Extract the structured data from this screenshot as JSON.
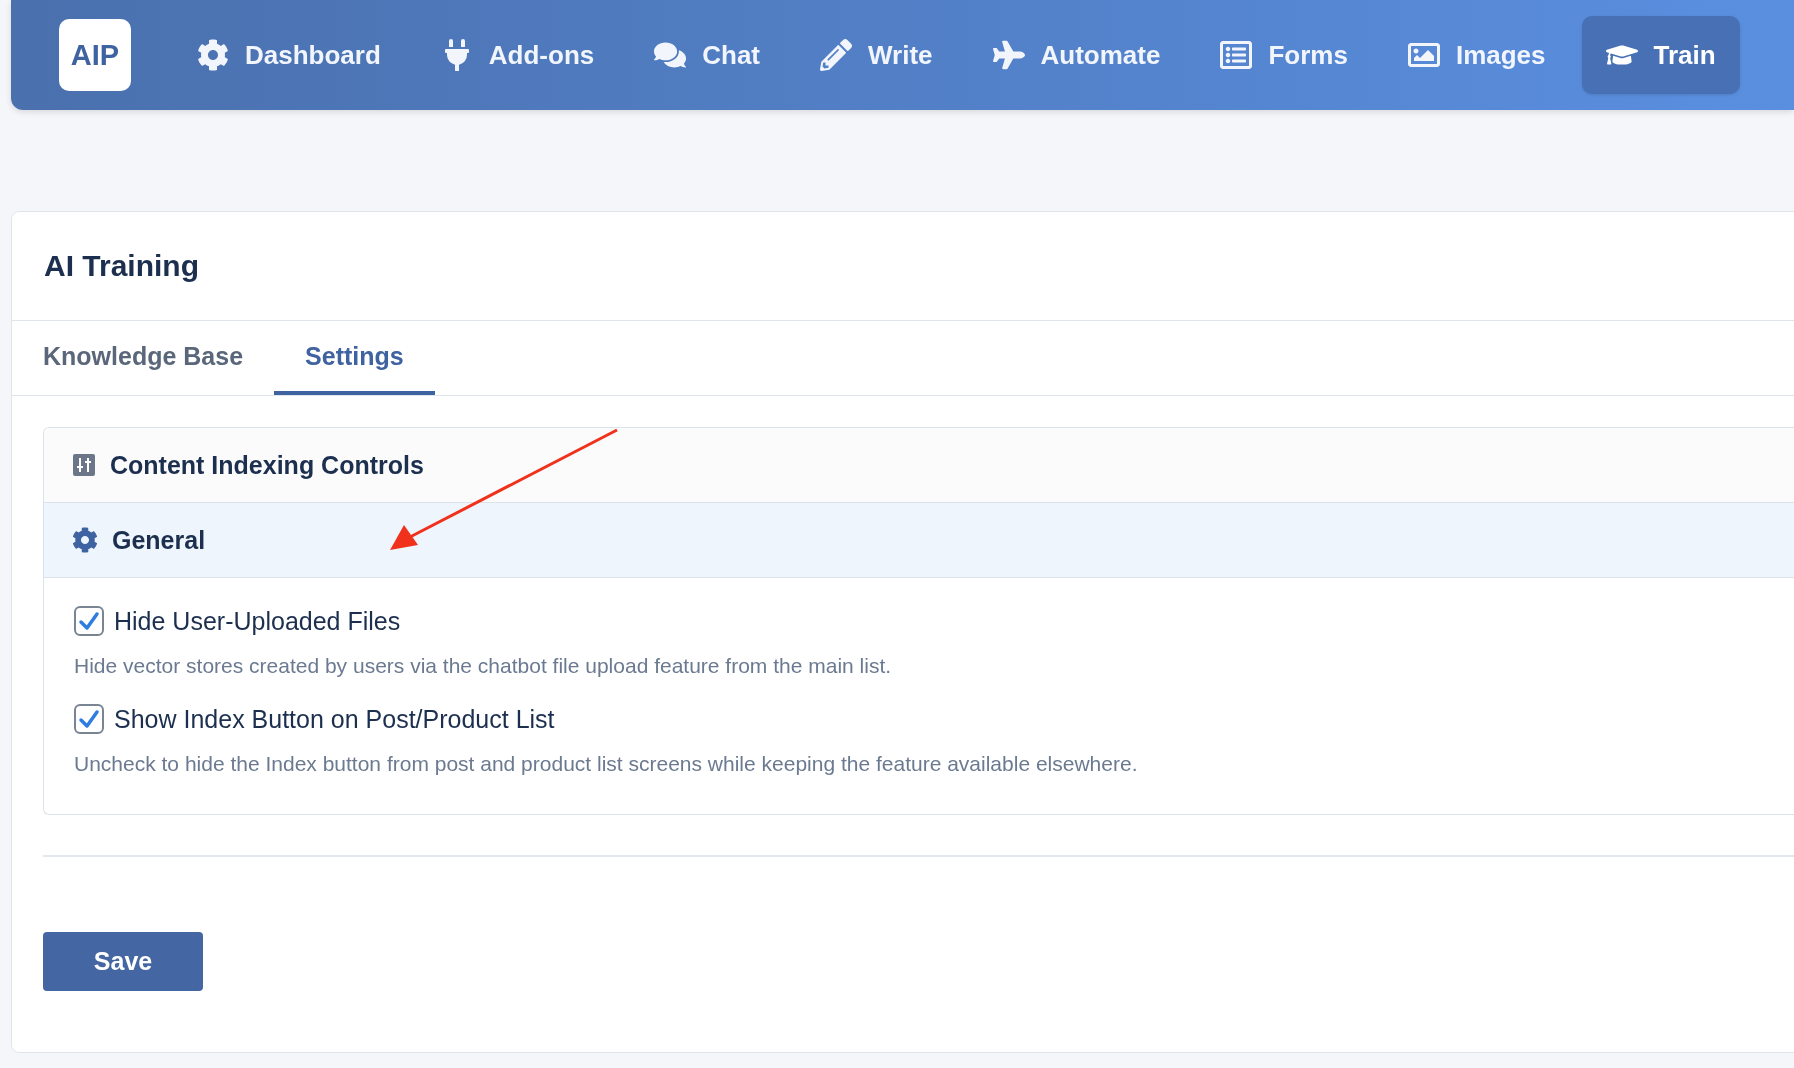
{
  "logo": {
    "text": "AIP"
  },
  "nav": {
    "items": [
      {
        "label": "Dashboard",
        "kind": "gear",
        "selected": false
      },
      {
        "label": "Add-ons",
        "kind": "plug",
        "selected": false
      },
      {
        "label": "Chat",
        "kind": "chat",
        "selected": false
      },
      {
        "label": "Write",
        "kind": "pencil",
        "selected": false
      },
      {
        "label": "Automate",
        "kind": "plane",
        "selected": false
      },
      {
        "label": "Forms",
        "kind": "form",
        "selected": false
      },
      {
        "label": "Images",
        "kind": "image",
        "selected": false
      },
      {
        "label": "Train",
        "kind": "cap",
        "selected": true
      }
    ]
  },
  "page": {
    "title": "AI Training",
    "tabs": [
      {
        "label": "Knowledge Base",
        "selected": false
      },
      {
        "label": "Settings",
        "selected": true
      }
    ],
    "sections": [
      {
        "title": "Content Indexing Controls",
        "kind": "sliders",
        "expanded": false
      },
      {
        "title": "General",
        "kind": "gear",
        "expanded": true
      }
    ],
    "options": [
      {
        "label": "Hide User-Uploaded Files",
        "checked": true,
        "description": "Hide vector stores created by users via the chatbot file upload feature from the main list."
      },
      {
        "label": "Show Index Button on Post/Product List",
        "checked": true,
        "description": "Uncheck to hide the Index button from post and product list screens while keeping the feature available elsewhere."
      }
    ],
    "save_button": "Save"
  }
}
